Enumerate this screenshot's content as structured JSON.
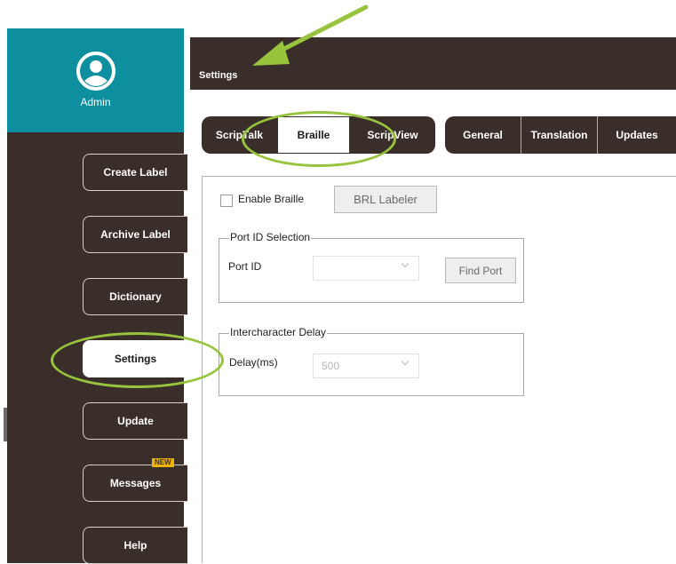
{
  "sidebar": {
    "user": "Admin",
    "items": [
      {
        "label": "Create Label"
      },
      {
        "label": "Archive Label"
      },
      {
        "label": "Dictionary"
      },
      {
        "label": "Settings"
      },
      {
        "label": "Update"
      },
      {
        "label": "Messages",
        "badge": "NEW"
      },
      {
        "label": "Help"
      }
    ]
  },
  "header": {
    "title": "Settings"
  },
  "tabs": {
    "group1": [
      {
        "label": "ScripTalk"
      },
      {
        "label": "Braille"
      },
      {
        "label": "ScripView"
      }
    ],
    "group2": [
      {
        "label": "General"
      },
      {
        "label": "Translation"
      },
      {
        "label": "Updates"
      }
    ]
  },
  "braille": {
    "enable_label": "Enable Braille",
    "brl_button": "BRL Labeler",
    "port_group": "Port ID Selection",
    "port_label": "Port ID",
    "port_value": "",
    "find_port": "Find Port",
    "delay_group": "Intercharacter Delay",
    "delay_label": "Delay(ms)",
    "delay_value": "500"
  },
  "colors": {
    "sidebar_bg": "#3a2e2a",
    "profile_bg": "#0e8fa0",
    "annotation": "#97c43c",
    "badge": "#f0b400"
  }
}
